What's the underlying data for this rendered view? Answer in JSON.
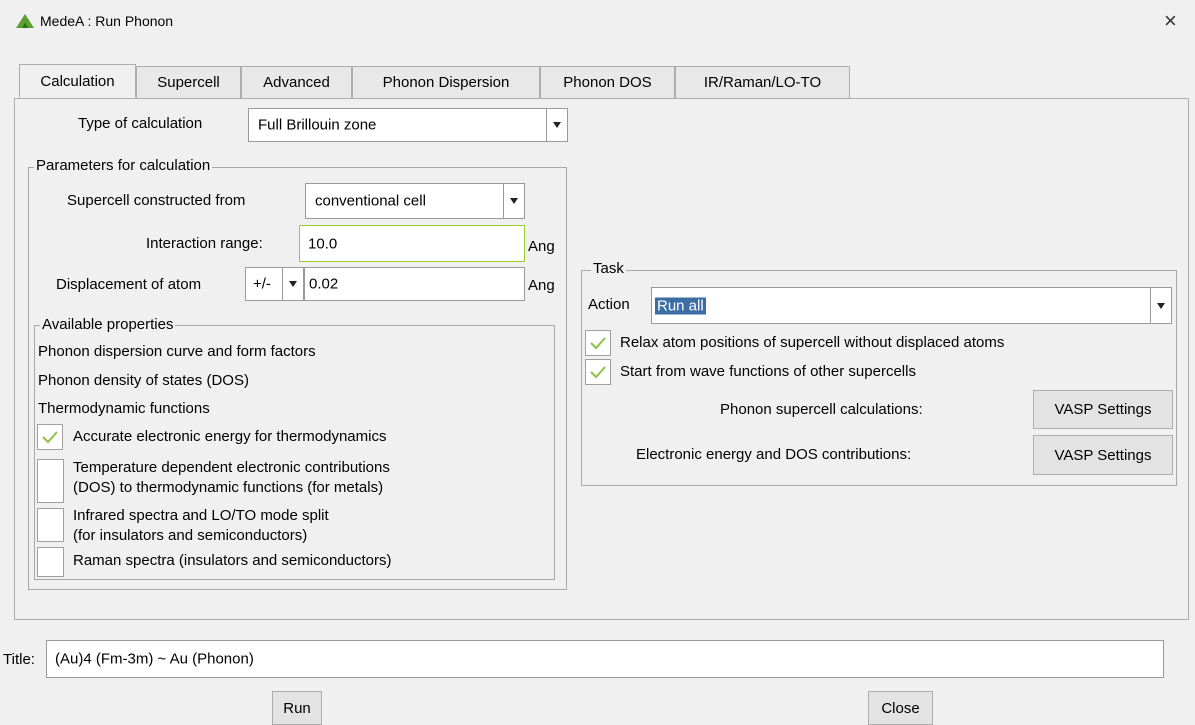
{
  "window": {
    "title": "MedeA : Run Phonon",
    "close_glyph": "×"
  },
  "tabs": [
    "Calculation",
    "Supercell",
    "Advanced",
    "Phonon Dispersion",
    "Phonon DOS",
    "IR/Raman/LO-TO"
  ],
  "calc": {
    "type_label": "Type of calculation",
    "type_value": "Full Brillouin zone"
  },
  "params": {
    "legend": "Parameters for calculation",
    "supercell_label": "Supercell constructed from",
    "supercell_value": "conventional cell",
    "range_label": "Interaction range:",
    "range_value": "10.0",
    "range_unit": "Ang",
    "disp_label": "Displacement of atom",
    "disp_sign": "+/-",
    "disp_value": "0.02",
    "disp_unit": "Ang"
  },
  "props": {
    "legend": "Available properties",
    "items": [
      "Phonon dispersion curve and form factors",
      "Phonon density of states (DOS)",
      "Thermodynamic functions"
    ],
    "checks": [
      {
        "checked": true,
        "lines": [
          "Accurate electronic energy for thermodynamics"
        ]
      },
      {
        "checked": false,
        "lines": [
          "Temperature dependent electronic contributions",
          "(DOS) to thermodynamic functions (for metals)"
        ]
      },
      {
        "checked": false,
        "lines": [
          "Infrared spectra and LO/TO mode split",
          "(for insulators and semiconductors)"
        ]
      },
      {
        "checked": false,
        "lines": [
          "Raman spectra (insulators and semiconductors)"
        ]
      }
    ]
  },
  "task": {
    "legend": "Task",
    "action_label": "Action",
    "action_value": "Run all",
    "checks": [
      {
        "checked": true,
        "label": "Relax atom positions of supercell without displaced atoms"
      },
      {
        "checked": true,
        "label": "Start from wave functions of other supercells"
      }
    ],
    "rows": [
      {
        "label": "Phonon supercell calculations:",
        "button": "VASP Settings"
      },
      {
        "label": "Electronic energy and DOS contributions:",
        "button": "VASP Settings"
      }
    ]
  },
  "footer": {
    "title_label": "Title:",
    "title_value": "(Au)4  (Fm-3m) ~ Au (Phonon)",
    "run_label": "Run",
    "close_label": "Close"
  },
  "colors": {
    "checkmark": "#8bc34a",
    "focus_border": "#9acd32",
    "selection": "#3a6ea5"
  }
}
